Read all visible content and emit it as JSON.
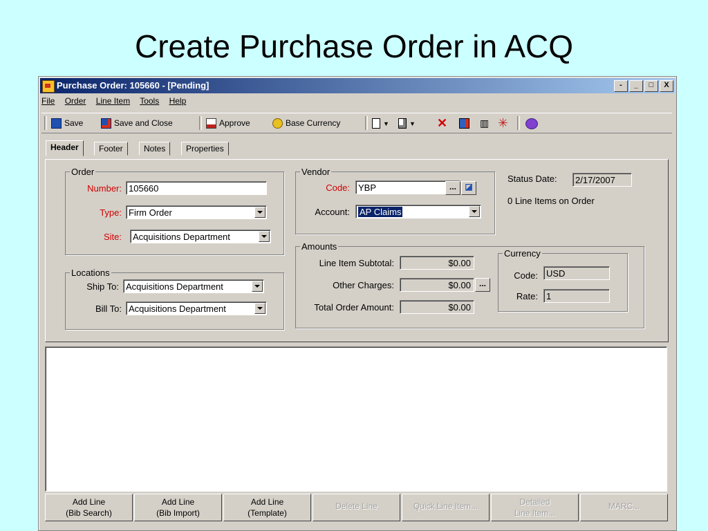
{
  "slide": {
    "title": "Create Purchase Order in ACQ"
  },
  "window": {
    "title": "Purchase Order:  105660 - [Pending]",
    "controls": [
      "-",
      "_",
      "□",
      "X"
    ]
  },
  "menu": [
    "File",
    "Order",
    "Line Item",
    "Tools",
    "Help"
  ],
  "toolbar": {
    "save": "Save",
    "save_close": "Save and Close",
    "approve": "Approve",
    "base_currency": "Base Currency",
    "icons": [
      "new-document-icon",
      "print-preview-icon",
      "delete-icon",
      "report-icon",
      "barcode-icon",
      "asterisk-icon",
      "help-icon"
    ]
  },
  "tabs": [
    "Header",
    "Footer",
    "Notes",
    "Properties"
  ],
  "order": {
    "legend": "Order",
    "number_label": "Number:",
    "number": "105660",
    "type_label": "Type:",
    "type": "Firm Order",
    "site_label": "Site:",
    "site": "Acquisitions Department"
  },
  "locations": {
    "legend": "Locations",
    "ship_to_label": "Ship To:",
    "ship_to": "Acquisitions Department",
    "bill_to_label": "Bill To:",
    "bill_to": "Acquisitions Department"
  },
  "vendor": {
    "legend": "Vendor",
    "code_label": "Code:",
    "code": "YBP",
    "account_label": "Account:",
    "account": "AP Claims"
  },
  "status": {
    "date_label": "Status Date:",
    "date": "2/17/2007",
    "line_items": "0 Line Items on Order"
  },
  "amounts": {
    "legend": "Amounts",
    "subtotal_label": "Line Item Subtotal:",
    "subtotal": "$0.00",
    "other_label": "Other Charges:",
    "other": "$0.00",
    "total_label": "Total Order Amount:",
    "total": "$0.00"
  },
  "currency": {
    "legend": "Currency",
    "code_label": "Code:",
    "code": "USD",
    "rate_label": "Rate:",
    "rate": "1"
  },
  "buttons": {
    "add_bib_search": "Add Line\n(Bib Search)",
    "add_bib_import": "Add Line\n(Bib Import)",
    "add_template": "Add Line\n(Template)",
    "delete_line": "Delete Line",
    "quick_line": "Quick Line Item...",
    "detailed_line": "Detailed\nLine Item...",
    "marc": "MARC..."
  }
}
